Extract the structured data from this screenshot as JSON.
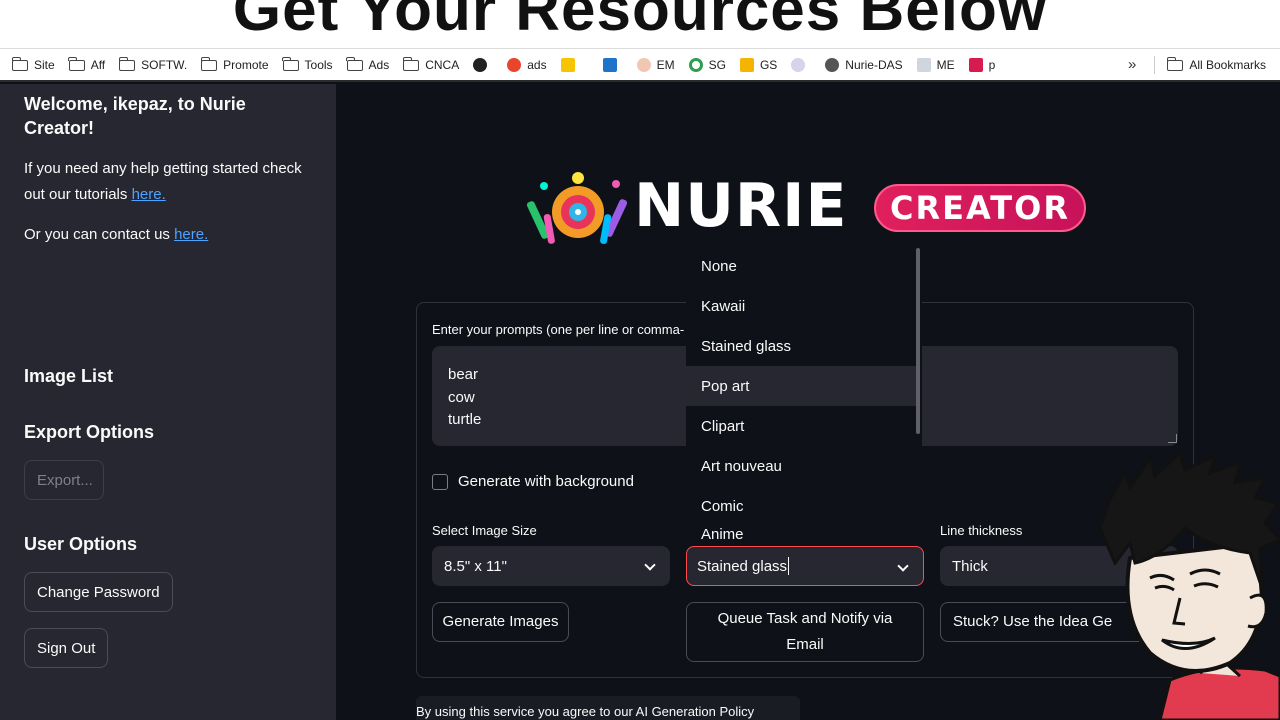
{
  "overlay_caption": "Get Your Resources Below",
  "bookmarks": {
    "items": [
      {
        "label": "Site",
        "icon": "folder-icon"
      },
      {
        "label": "Aff",
        "icon": "folder-icon"
      },
      {
        "label": "SOFTW.",
        "icon": "folder-icon"
      },
      {
        "label": "Promote",
        "icon": "folder-icon"
      },
      {
        "label": "Tools",
        "icon": "folder-icon"
      },
      {
        "label": "Ads",
        "icon": "folder-icon"
      },
      {
        "label": "CNCA",
        "icon": "folder-icon"
      },
      {
        "label": "",
        "icon": "openai-icon"
      },
      {
        "label": "ads",
        "icon": "ads-icon"
      },
      {
        "label": "",
        "icon": "keep-icon"
      },
      {
        "label": "",
        "icon": "outlook-icon"
      },
      {
        "label": "EM",
        "icon": "hand-icon"
      },
      {
        "label": "SG",
        "icon": "sg-icon"
      },
      {
        "label": "GS",
        "icon": "slides-icon"
      },
      {
        "label": "",
        "icon": "site-icon"
      },
      {
        "label": "Nurie-DAS",
        "icon": "globe-icon"
      },
      {
        "label": "ME",
        "icon": "page-icon"
      },
      {
        "label": "p",
        "icon": "crown-icon"
      }
    ],
    "more": "»",
    "all_bookmarks": "All Bookmarks"
  },
  "sidebar": {
    "welcome": "Welcome, ikepaz, to Nurie Creator!",
    "help_text": "If you need any help getting started check out our tutorials ",
    "help_link": "here.",
    "contact_text": "Or you can contact us ",
    "contact_link": "here.",
    "image_list": "Image List",
    "export_options": "Export Options",
    "export_button": "Export...",
    "user_options": "User Options",
    "change_password": "Change Password",
    "sign_out": "Sign Out"
  },
  "logo": {
    "title": "NURIE",
    "badge": "CREATOR"
  },
  "form": {
    "prompt_label": "Enter your prompts (one per line or comma-",
    "prompt_value": "bear\ncow\nturtle",
    "background_checkbox": "Generate with background",
    "image_size_label": "Select Image Size",
    "image_size_value": "8.5\" x 11\"",
    "style_value": "Stained glass",
    "line_thickness_label": "Line thickness",
    "line_thickness_value": "Thick",
    "generate_button": "Generate Images",
    "queue_button": "Queue Task and Notify via Email",
    "idea_button": "Stuck? Use the Idea Ge"
  },
  "style_dropdown": {
    "options": [
      "None",
      "Kawaii",
      "Stained glass",
      "Pop art",
      "Clipart",
      "Art nouveau",
      "Comic",
      "Anime"
    ],
    "highlighted": "Pop art"
  },
  "policy_text": "By using this service you agree to our AI Generation Policy"
}
